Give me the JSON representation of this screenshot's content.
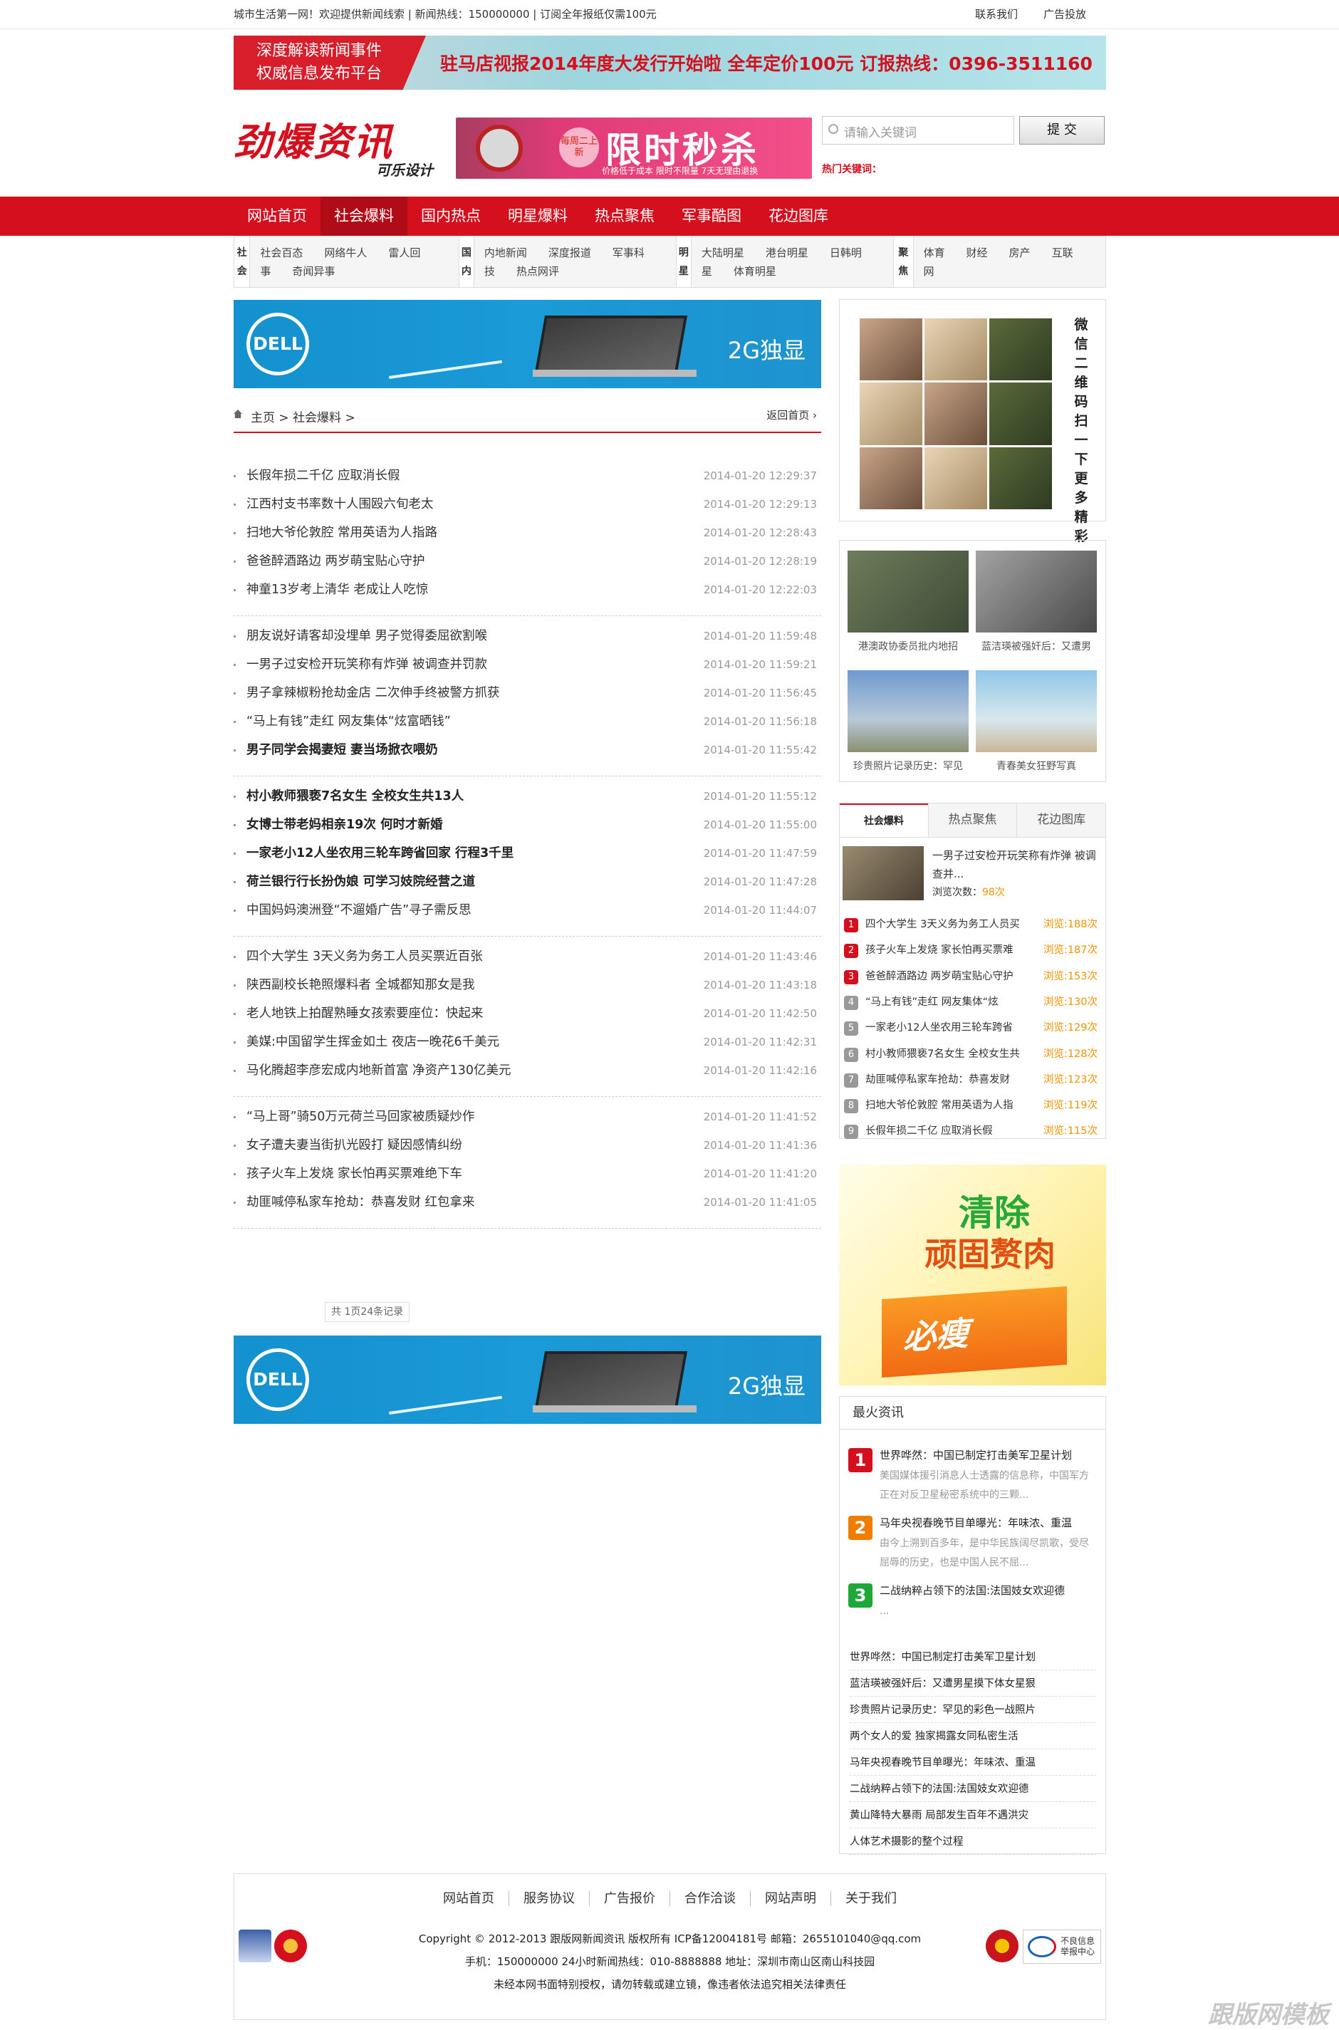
{
  "topbar": {
    "left": "城市生活第一网！欢迎提供新闻线索 | 新闻热线：150000000 | 订阅全年报纸仅需100元",
    "links": [
      "联系我们",
      "广告投放"
    ]
  },
  "head_banner": {
    "left_line1": "深度解读新闻事件",
    "left_line2": "权威信息发布平台",
    "text": "驻马店视报2014年度大发行开始啦  全年定价100元  订报热线：0396-3511160"
  },
  "logo": {
    "main": "劲爆资讯",
    "sub": "可乐设计"
  },
  "promo": {
    "tag": "每周二上新",
    "big": "限时秒杀",
    "small": "价格低于成本  限时不限量  7天无理由退换"
  },
  "search": {
    "placeholder": "请输入关键词",
    "button": "提 交",
    "hot_label": "热门关键词："
  },
  "nav": [
    "网站首页",
    "社会爆料",
    "国内热点",
    "明星爆料",
    "热点聚焦",
    "军事酷图",
    "花边图库"
  ],
  "subnav": [
    {
      "label": "社会",
      "links": [
        "社会百态",
        "网络牛人",
        "雷人回事",
        "奇闻异事"
      ]
    },
    {
      "label": "国内",
      "links": [
        "内地新闻",
        "深度报道",
        "军事科技",
        "热点网评"
      ]
    },
    {
      "label": "明星",
      "links": [
        "大陆明星",
        "港台明星",
        "日韩明星",
        "体育明星"
      ]
    },
    {
      "label": "聚焦",
      "links": [
        "体育",
        "财经",
        "房产",
        "互联网"
      ]
    }
  ],
  "dell_ad": {
    "brand": "DELL",
    "slogan": "2G独显"
  },
  "breadcrumb": {
    "home": "主页",
    "sep": ">",
    "section": "社会爆料 >",
    "back": "返回首页"
  },
  "news_groups": [
    [
      {
        "t": "长假年损二千亿 应取消长假",
        "d": "2014-01-20 12:29:37",
        "b": false
      },
      {
        "t": "江西村支书率数十人围殴六旬老太",
        "d": "2014-01-20 12:29:13",
        "b": false
      },
      {
        "t": "扫地大爷伦敦腔 常用英语为人指路",
        "d": "2014-01-20 12:28:43",
        "b": false
      },
      {
        "t": "爸爸醉酒路边 两岁萌宝贴心守护",
        "d": "2014-01-20 12:28:19",
        "b": false
      },
      {
        "t": "神童13岁考上清华 老成让人吃惊",
        "d": "2014-01-20 12:22:03",
        "b": false
      }
    ],
    [
      {
        "t": "朋友说好请客却没埋单 男子觉得委屈欲割喉",
        "d": "2014-01-20 11:59:48",
        "b": false
      },
      {
        "t": "一男子过安检开玩笑称有炸弹 被调查并罚款",
        "d": "2014-01-20 11:59:21",
        "b": false
      },
      {
        "t": "男子拿辣椒粉抢劫金店 二次伸手终被警方抓获",
        "d": "2014-01-20 11:56:45",
        "b": false
      },
      {
        "t": "“马上有钱”走红 网友集体“炫富晒钱”",
        "d": "2014-01-20 11:56:18",
        "b": false
      },
      {
        "t": "男子同学会揭妻短 妻当场掀衣喂奶",
        "d": "2014-01-20 11:55:42",
        "b": true
      }
    ],
    [
      {
        "t": "村小教师猥亵7名女生 全校女生共13人",
        "d": "2014-01-20 11:55:12",
        "b": true
      },
      {
        "t": "女博士带老妈相亲19次 何时才新婚",
        "d": "2014-01-20 11:55:00",
        "b": true
      },
      {
        "t": "一家老小12人坐农用三轮车跨省回家 行程3千里",
        "d": "2014-01-20 11:47:59",
        "b": true
      },
      {
        "t": "荷兰银行行长扮伪娘 可学习妓院经营之道",
        "d": "2014-01-20 11:47:28",
        "b": true
      },
      {
        "t": "中国妈妈澳洲登“不遛婚广告”寻子需反思",
        "d": "2014-01-20 11:44:07",
        "b": false
      }
    ],
    [
      {
        "t": "四个大学生 3天义务为务工人员买票近百张",
        "d": "2014-01-20 11:43:46",
        "b": false
      },
      {
        "t": "陕西副校长艳照爆料者 全城都知那女是我",
        "d": "2014-01-20 11:43:18",
        "b": false
      },
      {
        "t": "老人地铁上拍醒熟睡女孩索要座位：快起来",
        "d": "2014-01-20 11:42:50",
        "b": false
      },
      {
        "t": "美媒:中国留学生挥金如土 夜店一晚花6千美元",
        "d": "2014-01-20 11:42:31",
        "b": false
      },
      {
        "t": "马化腾超李彦宏成内地新首富 净资产130亿美元",
        "d": "2014-01-20 11:42:16",
        "b": false
      }
    ],
    [
      {
        "t": "“马上哥”骑50万元荷兰马回家被质疑炒作",
        "d": "2014-01-20 11:41:52",
        "b": false
      },
      {
        "t": "女子遭夫妻当街扒光殴打 疑因感情纠纷",
        "d": "2014-01-20 11:41:36",
        "b": false
      },
      {
        "t": "孩子火车上发烧 家长怕再买票难绝下车",
        "d": "2014-01-20 11:41:20",
        "b": false
      },
      {
        "t": "劫匪喊停私家车抢劫：恭喜发财 红包拿来",
        "d": "2014-01-20 11:41:05",
        "b": false
      }
    ]
  ],
  "pager": "共 1页24条记录",
  "qr_text": "微信二维码扫一下更多精彩",
  "pics": [
    "港澳政协委员批内地招",
    "蓝洁瑛被强奸后：又遭男",
    "珍贵照片记录历史：罕见",
    "青春美女狂野写真"
  ],
  "tabs": [
    "社会爆料",
    "热点聚焦",
    "花边图库"
  ],
  "feature": {
    "title": "一男子过安检开玩笑称有炸弹 被调查并...",
    "count_label": "浏览次数：",
    "count": "98次"
  },
  "ranking": [
    {
      "n": "1",
      "t": "四个大学生 3天义务为务工人员买",
      "v": "浏览:188次"
    },
    {
      "n": "2",
      "t": "孩子火车上发烧 家长怕再买票难",
      "v": "浏览:187次"
    },
    {
      "n": "3",
      "t": "爸爸醉酒路边 两岁萌宝贴心守护",
      "v": "浏览:153次"
    },
    {
      "n": "4",
      "t": "“马上有钱”走红 网友集体“炫",
      "v": "浏览:130次"
    },
    {
      "n": "5",
      "t": "一家老小12人坐农用三轮车跨省",
      "v": "浏览:129次"
    },
    {
      "n": "6",
      "t": "村小教师猥亵7名女生 全校女生共",
      "v": "浏览:128次"
    },
    {
      "n": "7",
      "t": "劫匪喊停私家车抢劫：恭喜发财",
      "v": "浏览:123次"
    },
    {
      "n": "8",
      "t": "扫地大爷伦敦腔 常用英语为人指",
      "v": "浏览:119次"
    },
    {
      "n": "9",
      "t": "长假年损二千亿 应取消长假",
      "v": "浏览:115次"
    }
  ],
  "green_ad": {
    "line1": "清除",
    "line2": "顽固赘肉",
    "brand": "必瘦"
  },
  "hot": {
    "title": "最火资讯",
    "top": [
      {
        "n": "1",
        "t": "世界哗然：中国已制定打击美军卫星计划",
        "d": "美国媒体援引消息人士透露的信息称，中国军方正在对反卫星秘密系统中的三颗..."
      },
      {
        "n": "2",
        "t": "马年央视春晚节目单曝光：年味浓、重温",
        "d": "由今上溯到百多年，是中华民族阔尽凯歌，受尽屈辱的历史，也是中国人民不屈..."
      },
      {
        "n": "3",
        "t": "二战纳粹占领下的法国:法国妓女欢迎德",
        "d": "..."
      }
    ],
    "list": [
      "世界哗然：中国已制定打击美军卫星计划",
      "蓝洁瑛被强奸后：又遭男星摸下体女星狠",
      "珍贵照片记录历史：罕见的彩色一战照片",
      "两个女人的爱 独家揭露女同私密生活",
      "马年央视春晚节目单曝光：年味浓、重温",
      "二战纳粹占领下的法国:法国妓女欢迎德",
      "黄山降特大暴雨 局部发生百年不遇洪灾",
      "人体艺术摄影的整个过程"
    ]
  },
  "footer": {
    "links": [
      "网站首页",
      "服务协议",
      "广告报价",
      "合作洽谈",
      "网站声明",
      "关于我们"
    ],
    "line1": "Copyright © 2012-2013 跟版网新闻资讯 版权所有 ICP备12004181号 邮箱：2655101040@qq.com",
    "line2": "手机：150000000 24小时新闻热线：010-8888888 地址：深圳市南山区南山科技园",
    "line3": "未经本网书面特别授权，请勿转载或建立镜，像违者依法追究相关法律责任",
    "badge_text": "不良信息举报中心"
  },
  "watermark": "跟版网模板"
}
